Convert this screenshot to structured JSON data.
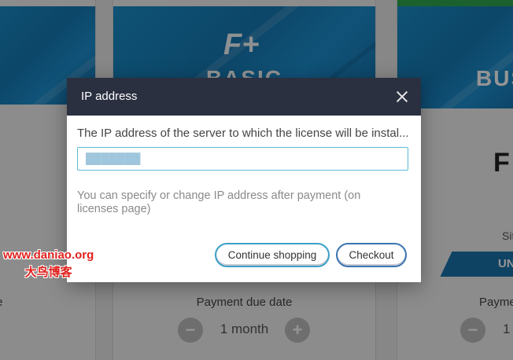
{
  "background": {
    "left_card": {
      "due_label_fragment": "te"
    },
    "middle_card": {
      "logo": "F+",
      "plan_name": "BASIC",
      "due_label": "Payment due date",
      "stepper": {
        "minus": "−",
        "value": "1 month",
        "plus": "+"
      }
    },
    "right_card": {
      "plan_name": "BUS",
      "price_fragment": "F",
      "site_fragment": "Sit",
      "badge_fragment": "UN",
      "due_label_fragment": "Payme",
      "stepper": {
        "minus": "−",
        "value": "1"
      }
    }
  },
  "modal": {
    "title": "IP address",
    "field_label": "The IP address of the server to which the license will be instal...",
    "ip_value": "███████",
    "hint": "You can specify or change IP address after payment (on licenses page)",
    "buttons": {
      "continue": "Continue shopping",
      "checkout": "Checkout"
    }
  },
  "watermark": {
    "line1": "www.daniao.org",
    "line2": "大鸟博客"
  },
  "colors": {
    "header_bg": "#2a3040",
    "banner_blue": "#1a8fc9",
    "input_border": "#5bbcd6",
    "button_border": "#3a8fc0",
    "watermark_red": "#e0201c",
    "right_card_accent": "#2fa84f"
  }
}
